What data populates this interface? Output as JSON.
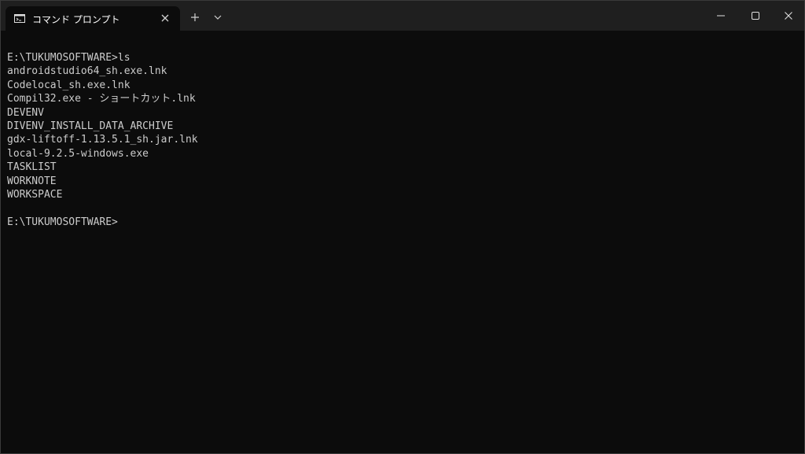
{
  "window": {
    "tab_title": "コマンド プロンプト"
  },
  "icons": {
    "tab_icon": "command-prompt-icon",
    "tab_close": "close-icon",
    "new_tab": "plus-icon",
    "dropdown": "chevron-down-icon",
    "minimize": "minimize-icon",
    "maximize": "maximize-icon",
    "close": "close-icon"
  },
  "colors": {
    "background": "#0c0c0c",
    "titlebar": "#1f1f1f",
    "text": "#cccccc"
  },
  "terminal": {
    "lines": [
      "E:\\TUKUMOSOFTWARE>ls",
      "androidstudio64_sh.exe.lnk",
      "Codelocal_sh.exe.lnk",
      "Compil32.exe - ショートカット.lnk",
      "DEVENV",
      "DIVENV_INSTALL_DATA_ARCHIVE",
      "gdx-liftoff-1.13.5.1_sh.jar.lnk",
      "local-9.2.5-windows.exe",
      "TASKLIST",
      "WORKNOTE",
      "WORKSPACE",
      "",
      "E:\\TUKUMOSOFTWARE>"
    ]
  }
}
